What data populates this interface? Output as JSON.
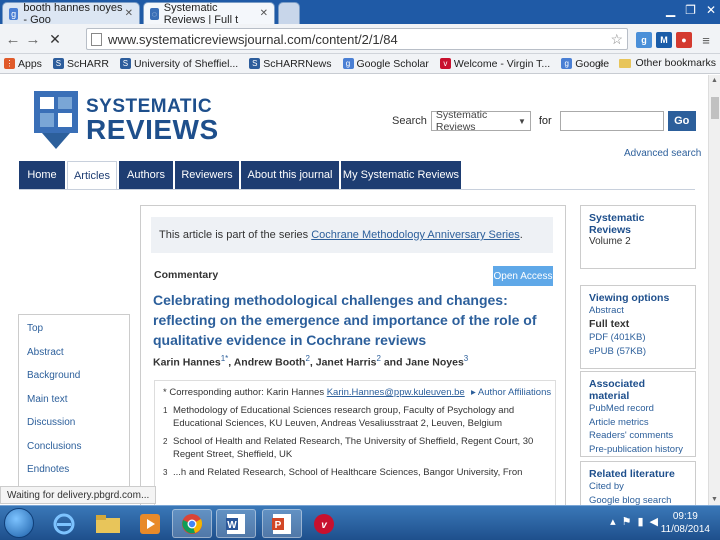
{
  "browser": {
    "tabs": [
      {
        "label": "booth hannes noyes - Goo"
      },
      {
        "label": "Systematic Reviews | Full t"
      }
    ],
    "url": "www.systematicreviewsjournal.com/content/2/1/84",
    "bookmarks": [
      {
        "label": "Apps"
      },
      {
        "label": "ScHARR"
      },
      {
        "label": "University of Sheffiel..."
      },
      {
        "label": "ScHARRNews"
      },
      {
        "label": "Google Scholar"
      },
      {
        "label": "Welcome - Virgin T..."
      },
      {
        "label": "Google"
      }
    ],
    "other_bookmarks": "Other bookmarks",
    "overflow": "»",
    "status": "Waiting for delivery.pbgrd.com..."
  },
  "site": {
    "logo_line1": "SYSTEMATIC",
    "logo_line2": "REVIEWS",
    "search_label": "Search",
    "search_scope": "Systematic Reviews",
    "search_for": "for",
    "search_go": "Go",
    "advanced_search": "Advanced search",
    "nav": [
      "Home",
      "Articles",
      "Authors",
      "Reviewers",
      "About this journal",
      "My Systematic Reviews"
    ]
  },
  "toc": [
    "Top",
    "Abstract",
    "Background",
    "Main text",
    "Discussion",
    "Conclusions",
    "Endnotes"
  ],
  "article": {
    "series_prefix": "This article is part of the series ",
    "series_link": "Cochrane Methodology Anniversary Series",
    "series_suffix": ".",
    "type": "Commentary",
    "open_access": "Open Access",
    "title": "Celebrating methodological challenges and changes: reflecting on the emergence and importance of the role of qualitative evidence in Cochrane reviews",
    "authors": [
      {
        "name": "Karin Hannes",
        "sup": "1*",
        "sep": ", "
      },
      {
        "name": "Andrew Booth",
        "sup": "2",
        "sep": ", "
      },
      {
        "name": "Janet Harris",
        "sup": "2",
        "sep": " and "
      },
      {
        "name": "Jane Noyes",
        "sup": "3",
        "sep": ""
      }
    ],
    "corr_prefix": "* Corresponding author: Karin Hannes ",
    "corr_email": "Karin.Hannes@ppw.kuleuven.be",
    "author_affiliations": "▸ Author Affiliations",
    "affiliations": [
      {
        "n": "1",
        "text": "Methodology of Educational Sciences research group, Faculty of Psychology and Educational Sciences, KU Leuven, Andreas Vesaliusstraat 2, Leuven, Belgium"
      },
      {
        "n": "2",
        "text": "School of Health and Related Research, The University of Sheffield, Regent Court, 30 Regent Street, Sheffield, UK"
      },
      {
        "n": "3",
        "text": "...h and Related Research, School of Healthcare Sciences, Bangor University, Fron"
      }
    ]
  },
  "sidebar": {
    "journal": "Systematic Reviews",
    "volume": "Volume 2",
    "viewing_options_title": "Viewing options",
    "viewing_options": [
      {
        "label": "Abstract",
        "current": false
      },
      {
        "label": "Full text",
        "current": true
      },
      {
        "label": "PDF (401KB)",
        "current": false
      },
      {
        "label": "ePUB (57KB)",
        "current": false
      }
    ],
    "associated_title": "Associated material",
    "associated": [
      "PubMed record",
      "Article metrics",
      "Readers' comments",
      "Pre-publication history"
    ],
    "related_title": "Related literature",
    "related": [
      "Cited by",
      "Google blog search"
    ]
  },
  "taskbar": {
    "time": "09:19",
    "date": "11/08/2014"
  }
}
